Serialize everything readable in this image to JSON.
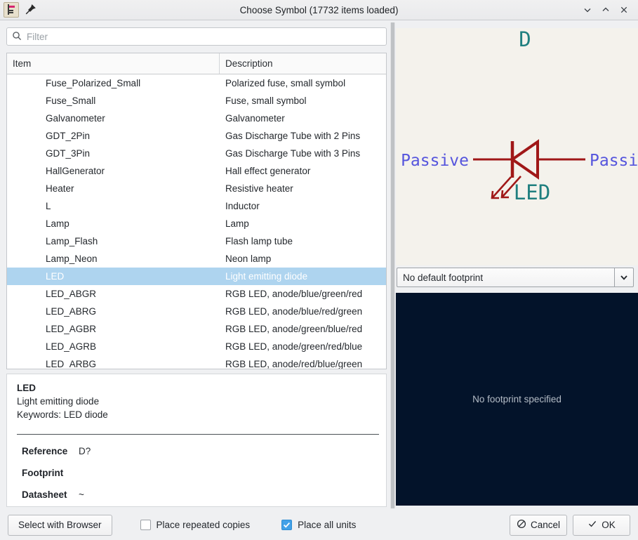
{
  "window": {
    "title": "Choose Symbol (17732 items loaded)",
    "app_icon": "kicad-eeschema-icon",
    "pin_icon": "pin-icon",
    "minimize_glyph": "⌄",
    "maximize_glyph": "⌃",
    "close_glyph": "✕"
  },
  "filter": {
    "placeholder": "Filter",
    "value": "",
    "icon": "search-icon"
  },
  "list": {
    "columns": [
      "Item",
      "Description"
    ],
    "selected_index": 11,
    "rows": [
      {
        "item": "Fuse_Polarized_Small",
        "description": "Polarized fuse, small symbol"
      },
      {
        "item": "Fuse_Small",
        "description": "Fuse, small symbol"
      },
      {
        "item": "Galvanometer",
        "description": "Galvanometer"
      },
      {
        "item": "GDT_2Pin",
        "description": "Gas Discharge Tube with 2 Pins"
      },
      {
        "item": "GDT_3Pin",
        "description": "Gas Discharge Tube with 3 Pins"
      },
      {
        "item": "HallGenerator",
        "description": "Hall effect generator"
      },
      {
        "item": "Heater",
        "description": "Resistive heater"
      },
      {
        "item": "L",
        "description": "Inductor"
      },
      {
        "item": "Lamp",
        "description": "Lamp"
      },
      {
        "item": "Lamp_Flash",
        "description": "Flash lamp tube"
      },
      {
        "item": "Lamp_Neon",
        "description": "Neon lamp"
      },
      {
        "item": "LED",
        "description": "Light emitting diode"
      },
      {
        "item": "LED_ABGR",
        "description": "RGB LED, anode/blue/green/red"
      },
      {
        "item": "LED_ABRG",
        "description": "RGB LED, anode/blue/red/green"
      },
      {
        "item": "LED_AGBR",
        "description": "RGB LED, anode/green/blue/red"
      },
      {
        "item": "LED_AGRB",
        "description": "RGB LED, anode/green/red/blue"
      },
      {
        "item": "LED_ARBG",
        "description": "RGB LED, anode/red/blue/green"
      }
    ]
  },
  "details": {
    "name": "LED",
    "description": "Light emitting diode",
    "keywords": "Keywords: LED diode",
    "fields": [
      {
        "label": "Reference",
        "value": "D?"
      },
      {
        "label": "Footprint",
        "value": ""
      },
      {
        "label": "Datasheet",
        "value": "~"
      }
    ]
  },
  "symbol_preview": {
    "reference_label": "D",
    "value_label": "LED",
    "pin_left_label": "Passive",
    "pin_right_label": "Passive",
    "colors": {
      "background": "#f4f2ec",
      "body": "#a01818",
      "text": "#1f7f7f",
      "pin_text": "#5555dd"
    }
  },
  "footprint": {
    "selected": "No default footprint",
    "dropdown_icon": "chevron-down-icon",
    "preview_empty_text": "No footprint specified",
    "preview_background": "#03132a"
  },
  "bottom_bar": {
    "select_with_browser": "Select with Browser",
    "place_repeated_copies": {
      "label": "Place repeated copies",
      "checked": false
    },
    "place_all_units": {
      "label": "Place all units",
      "checked": true
    },
    "cancel": "Cancel",
    "ok": "OK",
    "cancel_icon": "no-entry-icon",
    "ok_icon": "check-icon"
  },
  "accent_colors": {
    "selection_blue": "#aed4ef",
    "checkbox_blue": "#42a1e8"
  }
}
